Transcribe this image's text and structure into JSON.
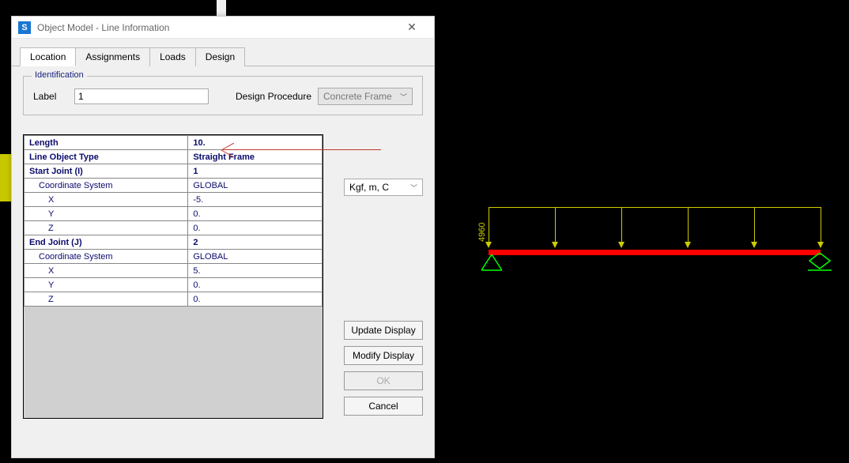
{
  "window": {
    "title": "Object Model - Line Information",
    "app_icon_letter": "S"
  },
  "tabs": [
    "Location",
    "Assignments",
    "Loads",
    "Design"
  ],
  "active_tab": "Location",
  "identification": {
    "legend": "Identification",
    "label_caption": "Label",
    "label_value": "1",
    "dp_caption": "Design Procedure",
    "dp_value": "Concrete Frame"
  },
  "grid_rows": [
    {
      "key": "Length",
      "val": "10.",
      "ind": 0,
      "bold": true
    },
    {
      "key": "Line Object Type",
      "val": "Straight Frame",
      "ind": 0,
      "bold": true
    },
    {
      "key": "Start Joint (I)",
      "val": "1",
      "ind": 0,
      "bold": true
    },
    {
      "key": "Coordinate System",
      "val": "GLOBAL",
      "ind": 1,
      "bold": false
    },
    {
      "key": "X",
      "val": "-5.",
      "ind": 2,
      "bold": false
    },
    {
      "key": "Y",
      "val": "0.",
      "ind": 2,
      "bold": false
    },
    {
      "key": "Z",
      "val": "0.",
      "ind": 2,
      "bold": false
    },
    {
      "key": "End Joint (J)",
      "val": "2",
      "ind": 0,
      "bold": true
    },
    {
      "key": "Coordinate System",
      "val": "GLOBAL",
      "ind": 1,
      "bold": false
    },
    {
      "key": "X",
      "val": "5.",
      "ind": 2,
      "bold": false
    },
    {
      "key": "Y",
      "val": "0.",
      "ind": 2,
      "bold": false
    },
    {
      "key": "Z",
      "val": "0.",
      "ind": 2,
      "bold": false
    }
  ],
  "units_value": "Kgf, m, C",
  "buttons": {
    "update": "Update Display",
    "modify": "Modify Display",
    "ok": "OK",
    "cancel": "Cancel"
  },
  "beam": {
    "load_label": "4960",
    "arrow_count": 6
  }
}
